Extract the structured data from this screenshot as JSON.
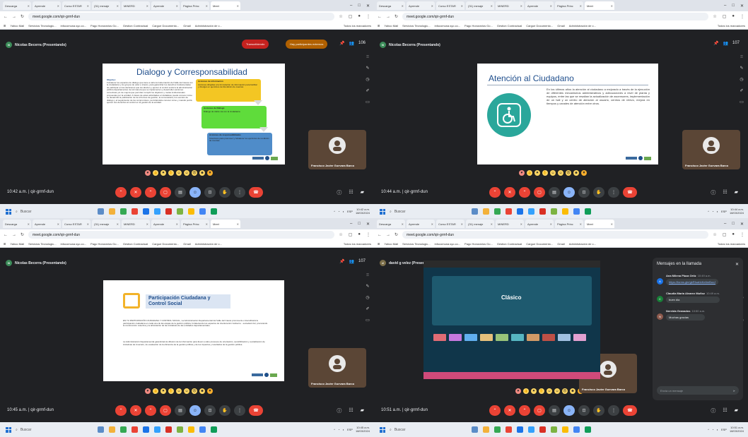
{
  "browser": {
    "tabs": [
      "Descarga",
      "Aprende",
      "Curso ESTAR",
      "(31) menaje",
      "MINERD",
      "Aprende",
      "Página Princ",
      "Meet"
    ],
    "url": "meet.google.com/qir-grmf-dun",
    "bookmarks": [
      "Yahoo Mail",
      "Servicios Tecnologic...",
      "infocomuna.syc.co...",
      "Pago Honorarios Go...",
      "Gestion Contractual",
      "Cargue Documento...",
      "Gmail",
      "Administración de c..."
    ],
    "all_bookmarks": "Todos los marcadores"
  },
  "meet": {
    "meeting_code": "qir-grmf-dun",
    "presenter_1": "Nicolas Becerra (Presentando)",
    "presenter_2": "david g velez (Presentando)",
    "transcribing": "Transcribiendo",
    "external_participants": "Hay participantes externos",
    "participant_count": "106",
    "participant_count_2": "107",
    "participant_name": "Francisco Javier Guevara Barco",
    "times": [
      "10:42 a.m.",
      "10:44 a.m.",
      "10:45 a.m.",
      "10:51 a.m."
    ]
  },
  "slides": {
    "s1": {
      "title": "Dialogo y Corresponsabilidad",
      "objective_head": "Objetivo:",
      "objective_text": "Fortalecer los espacios de diálogo que tiene a cabo la Gobernación del Valle del Cauca con la ciudadanía y los grupos de valor e interés, para garantizar los derechos fundamentales de participar en las decisiones que les afecten y ejercer el control social a la administración pública departamental, de tal manera que se implementen y desarrollen acciones correctivas y/o de mejora que permitan cumplir los objetivos y metas institucionales propuestas por la entidad. A través de estas actividades el ciudadano puede conocer cómo se desarrolló la publicación de los informes de gestión, la convocatoria, los eventos de diálogo y el seguimiento de los compromisos, permitiéndole conocer cómo y cuando podrá ejercer sus derechos al control en la gestión de la entidad.",
      "box1_title": "Acciones de información",
      "box1_text": "Acciones dirigidas a la formulación de información para facilitar y divulgar en ejercicios de Rendición de cuentas",
      "box2_title": "Acciones de Diálogo",
      "box2_text": "Diálogo de doble vía con la ciudadanía",
      "box3_title": "Acciones de responsabilidades",
      "box3_text": "Incentivos para promover y fortalecer los ejercicios de rendición de cuentas"
    },
    "s2": {
      "title": "Atención al Ciudadano",
      "text": "En los últimos años la atención al ciudadano a mejorado a través de la ejecución de diferentes mecanismos administrativos y adecuaciones a nivel de planta y equipos, entre las que se resaltan la actualización de ascensores, implementación de un hall y un centro de atención al usuario, centros de relevo, mejora en tiempos y canales de atención entre otros."
    },
    "s3": {
      "title": "Participación Ciudadana y Control Social",
      "para1": "EN TU PARTICIPACIÓN CIUDADANA Y CONTROL SOCIAL, La Administración Departamental del Valle del Cauca promoverá e intensificará la participación ciudadana en cada una de las etapas de la gestión pública, fortaleciendo los espacios de interlocución Gobierno - sociedad civil, procurando la construcción colectiva y la articulación de las iniciativas de las entidades departamentales.",
      "para2": "La Administración Departamental garantizará la difusión de la información para llevar a cabo procesos de orientación, sensibilización y socialización de iniciativas de inversión, de evaluación de la eficiencia de la gestión pública y de los impactos y resultados de la gestión pública."
    },
    "s4": {
      "title": "Clásico"
    }
  },
  "chat": {
    "title": "Mensajes en la llamada",
    "messages": [
      {
        "initial": "A",
        "name": "Ana Milena Plaza Ortiz",
        "time": "10:49 a.m.",
        "text": "https://forms.gle/gkRfuahbKe6mBuxJ",
        "color": "#1a73e8",
        "link": true
      },
      {
        "initial": "C",
        "name": "Claudia Maria Alvarez Muñoz",
        "time": "10:49 a.m.",
        "text": "buen dia",
        "color": "#188038",
        "link": false
      },
      {
        "initial": "N",
        "name": "Nereida Granados",
        "time": "10:50 a.m.",
        "text": "Muchas gracias",
        "color": "#8e5a4d",
        "link": false
      }
    ],
    "input_placeholder": "Envía un mensaje"
  },
  "taskbar": {
    "search": "Buscar",
    "language": "ESP",
    "clock": [
      "10:42 a.m.",
      "10:44 a.m.",
      "10:45 a.m.",
      "10:51 a.m."
    ],
    "date": "18/03/2024"
  },
  "icons": [
    "search-icon",
    "mic-off-icon",
    "present-icon",
    "captions-icon",
    "emoji-icon",
    "hand-icon",
    "more-icon",
    "hangup-icon",
    "info-icon",
    "people-icon",
    "chat-icon",
    "activities-icon"
  ],
  "colors": {
    "accent_red": "#ea4335",
    "accent_blue": "#8ab4f8",
    "meet_bg": "#202124",
    "slide_title": "#1f4e8c"
  }
}
